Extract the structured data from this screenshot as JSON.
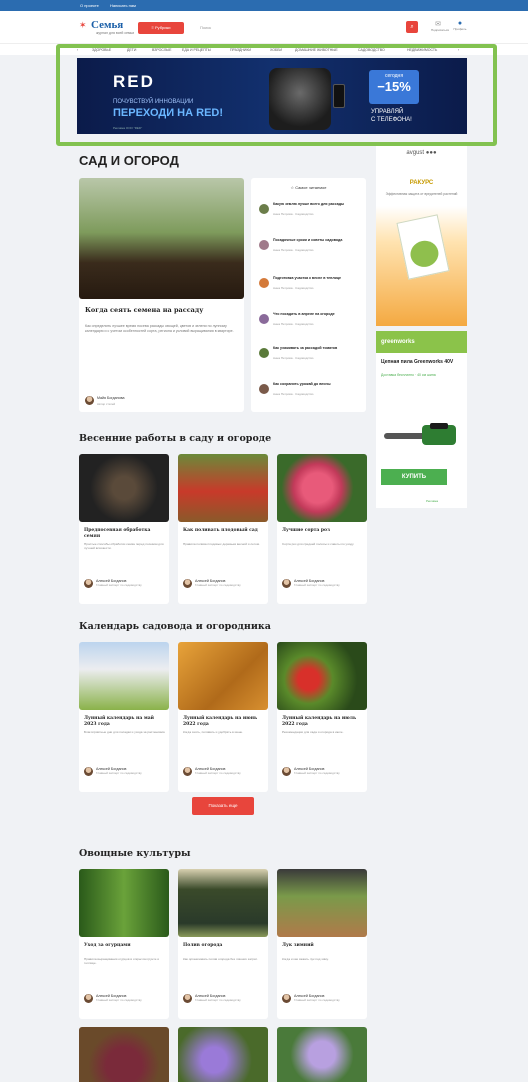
{
  "topbar": {
    "phone": "О проекте",
    "subscribe": "Написать нам",
    "right1": "●",
    "right2": "●"
  },
  "header": {
    "logo": "Семья",
    "logo_sub": "журнал для всей семьи",
    "rubrics_label": "≡ Рубрики",
    "search_placeholder": "Поиск",
    "search_icon": "search-icon",
    "icon_labels": [
      "Подписаться",
      "Профиль"
    ]
  },
  "nav": {
    "items": [
      "‹",
      "Здоровье",
      "Дети",
      "Взрослые",
      "Еда и рецепты",
      "Праздники",
      "Хобби",
      "Домашние животные",
      "Садоводство",
      "Недвижимость",
      "›"
    ]
  },
  "top_ad": {
    "brand": "RED",
    "line1": "ПОЧУВСТВУЙ ИННОВАЦИИ",
    "line2": "ПЕРЕХОДИ НА RED!",
    "fine": "Реклама ООО \"RED\"",
    "disc_title": "сегодня",
    "disc_value": "−15%",
    "control": "УПРАВЛЯЙ\nС ТЕЛЕФОНА!"
  },
  "main": {
    "title": "САД И ОГОРОД",
    "feature": {
      "title": "Когда сеять семена на рассаду",
      "text": "Как определить лучшее время посева рассады овощей, цветов и зелени по лунному календарю и с учетом особенностей сорта, региона и условий выращивания в квартире.",
      "author": "Майя Богданова",
      "role": "Автор статей"
    },
    "popular": {
      "head": "☆ Самое читаемое",
      "items": [
        {
          "title": "Какую землю лучше всего для рассады",
          "sub": "Анна Петрова · Садоводство"
        },
        {
          "title": "Посадочные сроки и советы садовода",
          "sub": "Анна Петрова · Садоводство"
        },
        {
          "title": "Подготовка участка к весне в теплице",
          "sub": "Анна Петрова · Садоводство"
        },
        {
          "title": "Что посадить в апреле на огороде",
          "sub": "Анна Петрова · Садоводство"
        },
        {
          "title": "Как ухаживать за рассадой томатов",
          "sub": "Анна Петрова · Садоводство"
        },
        {
          "title": "Как сохранить урожай до весны",
          "sub": "Анна Петрова · Садоводство"
        }
      ]
    }
  },
  "side_ad1": {
    "brand": "avgust ●●●",
    "product": "РАКУРС",
    "desc": "Эффективная защита от вредителей растений"
  },
  "side_ad2": {
    "brand": "greenworks",
    "name": "Цепная пила Greenworks 40V",
    "sub": "Доставка бесплатно · 40 см шина",
    "buy": "КУПИТЬ",
    "fine": "Реклама"
  },
  "spring": {
    "title": "Весенние работы в саду и огороде",
    "cards": [
      {
        "title": "Предпосевная обработка семян",
        "text": "Простые способы обработки семян перед посевом для лучшей всхожести.",
        "author": "Алексей Богданов",
        "role": "Главный эксперт по садоводству"
      },
      {
        "title": "Как поливать плодовый сад",
        "text": "Правила полива плодовых деревьев весной и летом.",
        "author": "Алексей Богданов",
        "role": "Главный эксперт по садоводству"
      },
      {
        "title": "Лучшие сорта роз",
        "text": "Сорта роз для средней полосы и советы по уходу.",
        "author": "Алексей Богданов",
        "role": "Главный эксперт по садоводству"
      }
    ]
  },
  "calendar": {
    "title": "Календарь садовода и огородника",
    "cards": [
      {
        "title": "Лунный календарь на май 2023 года",
        "text": "Благоприятные дни для посадки и ухода за растениями.",
        "author": "Алексей Богданов",
        "role": "Главный эксперт по садоводству"
      },
      {
        "title": "Лунный календарь на июнь 2022 года",
        "text": "Когда сеять, поливать и удобрять в июне.",
        "author": "Алексей Богданов",
        "role": "Главный эксперт по садоводству"
      },
      {
        "title": "Лунный календарь на июль 2022 года",
        "text": "Рекомендации для сада и огорода в июле.",
        "author": "Алексей Богданов",
        "role": "Главный эксперт по садоводству"
      }
    ],
    "more": "Показать еще"
  },
  "vegetables": {
    "title": "Овощные культуры",
    "cards": [
      {
        "title": "Уход за огурцами",
        "text": "Правила выращивания огурцов в открытом грунте и теплице.",
        "author": "Алексей Богданов",
        "role": "Главный эксперт по садоводству"
      },
      {
        "title": "Полив огорода",
        "text": "Как организовать полив огорода без лишних затрат.",
        "author": "Алексей Богданов",
        "role": "Главный эксперт по садоводству"
      },
      {
        "title": "Лук зимний",
        "text": "Когда и как сажать лук под зиму.",
        "author": "Алексей Богданов",
        "role": "Главный эксперт по садоводству"
      }
    ]
  }
}
